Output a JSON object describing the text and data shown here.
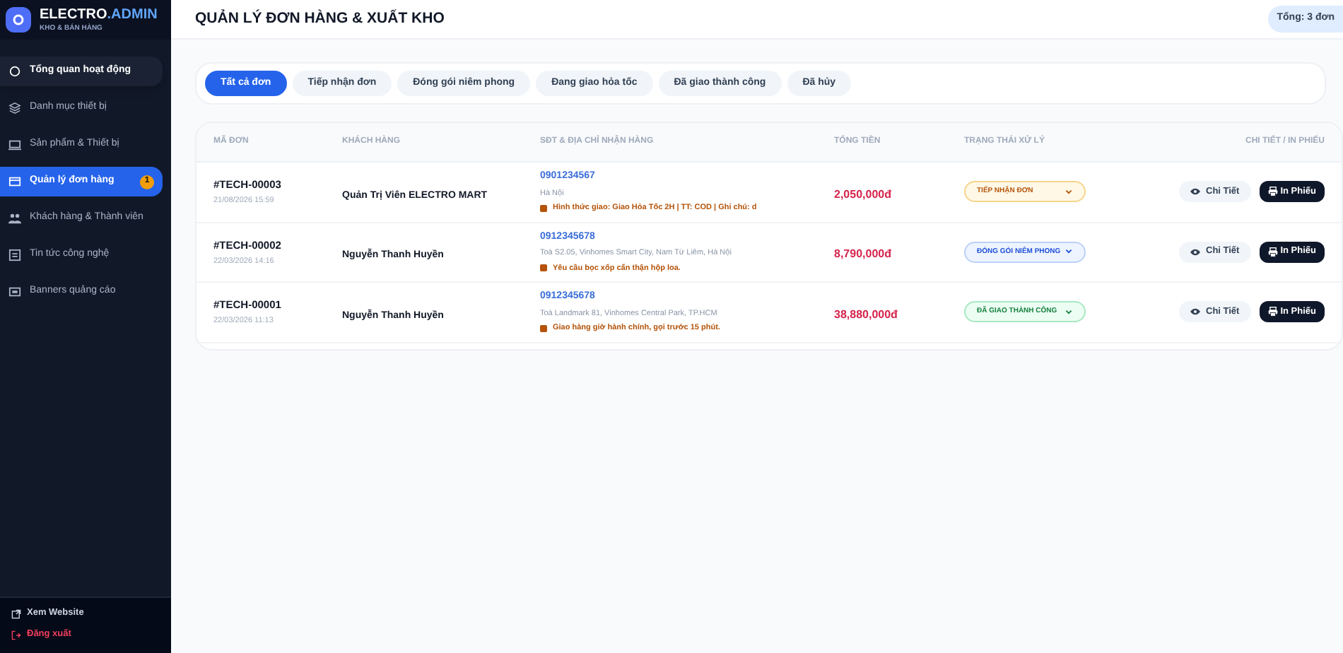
{
  "brand": {
    "name": "ELECTRO",
    "suffix": ".ADMIN",
    "subtitle": "KHO & BÁN HÀNG"
  },
  "sidebar": {
    "items": [
      {
        "label": "Tổng quan hoạt động",
        "selected": false,
        "hover": true
      },
      {
        "label": "Danh mục thiết bị",
        "selected": false,
        "hover": false
      },
      {
        "label": "Sản phẩm & Thiết bị",
        "selected": false,
        "hover": false
      },
      {
        "label": "Quản lý đơn hàng",
        "selected": true,
        "hover": false,
        "badge": "1"
      },
      {
        "label": "Khách hàng & Thành viên",
        "selected": false,
        "hover": false
      },
      {
        "label": "Tin tức công nghệ",
        "selected": false,
        "hover": false
      },
      {
        "label": "Banners quảng cáo",
        "selected": false,
        "hover": false
      }
    ],
    "footer": [
      {
        "label": "Xem Website",
        "kind": "link"
      },
      {
        "label": "Đăng xuất",
        "kind": "logout"
      }
    ]
  },
  "header": {
    "title": "QUẢN LÝ ĐƠN HÀNG & XUẤT KHO",
    "total": "Tổng: 3 đơn"
  },
  "filters": [
    {
      "label": "Tất cả đơn",
      "selected": true
    },
    {
      "label": "Tiếp nhận đơn",
      "selected": false
    },
    {
      "label": "Đóng gói niêm phong",
      "selected": false
    },
    {
      "label": "Đang giao hỏa tốc",
      "selected": false
    },
    {
      "label": "Đã giao thành công",
      "selected": false
    },
    {
      "label": "Đã hủy",
      "selected": false
    }
  ],
  "table": {
    "columns": [
      "MÃ ĐƠN",
      "KHÁCH HÀNG",
      "SĐT & ĐỊA CHỈ NHẬN HÀNG",
      "TỔNG TIỀN",
      "TRẠNG THÁI XỬ LÝ",
      "CHI TIẾT / IN PHIẾU"
    ],
    "rows": [
      {
        "code": "#TECH-00003",
        "date": "21/08/2026 15:59",
        "customer": "Quản Trị Viên ELECTRO MART",
        "phone": "0901234567",
        "address": "Hà Nội",
        "note": "Hình thức giao: Giao Hỏa Tốc 2H | TT: COD | Ghi chú: d",
        "total": "2,050,000đ",
        "status": {
          "label": "TIẾP NHẬN ĐƠN",
          "kind": "received"
        },
        "detail": "Chi Tiết",
        "print": "In Phiếu"
      },
      {
        "code": "#TECH-00002",
        "date": "22/03/2026 14:16",
        "customer": "Nguyễn Thanh Huyền",
        "phone": "0912345678",
        "address": "Toà S2.05, Vinhomes Smart City, Nam Từ Liêm, Hà Nội",
        "note": "Yêu cầu bọc xốp cẩn thận hộp loa.",
        "total": "8,790,000đ",
        "status": {
          "label": "ĐÓNG GÓI NIÊM PHONG",
          "kind": "packing"
        },
        "detail": "Chi Tiết",
        "print": "In Phiếu"
      },
      {
        "code": "#TECH-00001",
        "date": "22/03/2026 11:13",
        "customer": "Nguyễn Thanh Huyền",
        "phone": "0912345678",
        "address": "Toà Landmark 81, Vinhomes Central Park, TP.HCM",
        "note": "Giao hàng giờ hành chính, gọi trước 15 phút.",
        "total": "38,880,000đ",
        "status": {
          "label": "ĐÃ GIAO THÀNH CÔNG",
          "kind": "delivered"
        },
        "detail": "Chi Tiết",
        "print": "In Phiếu"
      }
    ]
  }
}
